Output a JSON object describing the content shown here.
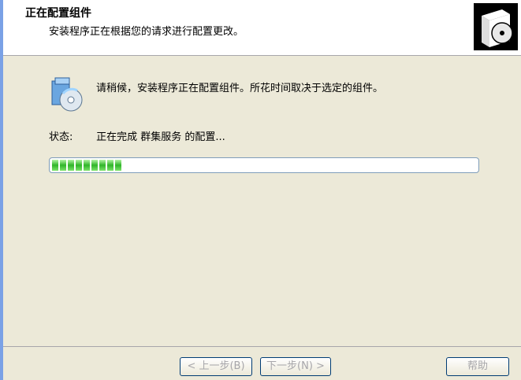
{
  "header": {
    "title": "正在配置组件",
    "subtitle": "安装程序正在根据您的请求进行配置更改。",
    "icon": "cd-box-icon"
  },
  "content": {
    "message": "请稍候，安装程序正在配置组件。所花时间取决于选定的组件。",
    "status_label": "状态:",
    "status_text": "正在完成 群集服务 的配置...",
    "progress_fraction": 0.16,
    "icon": "install-cd-icon"
  },
  "buttons": {
    "back": "< 上一步(B)",
    "next": "下一步(N) >",
    "help": "帮助"
  },
  "colors": {
    "progress_green": "#30b529",
    "panel": "#ece9d8",
    "accent": "#7aa1e6"
  }
}
